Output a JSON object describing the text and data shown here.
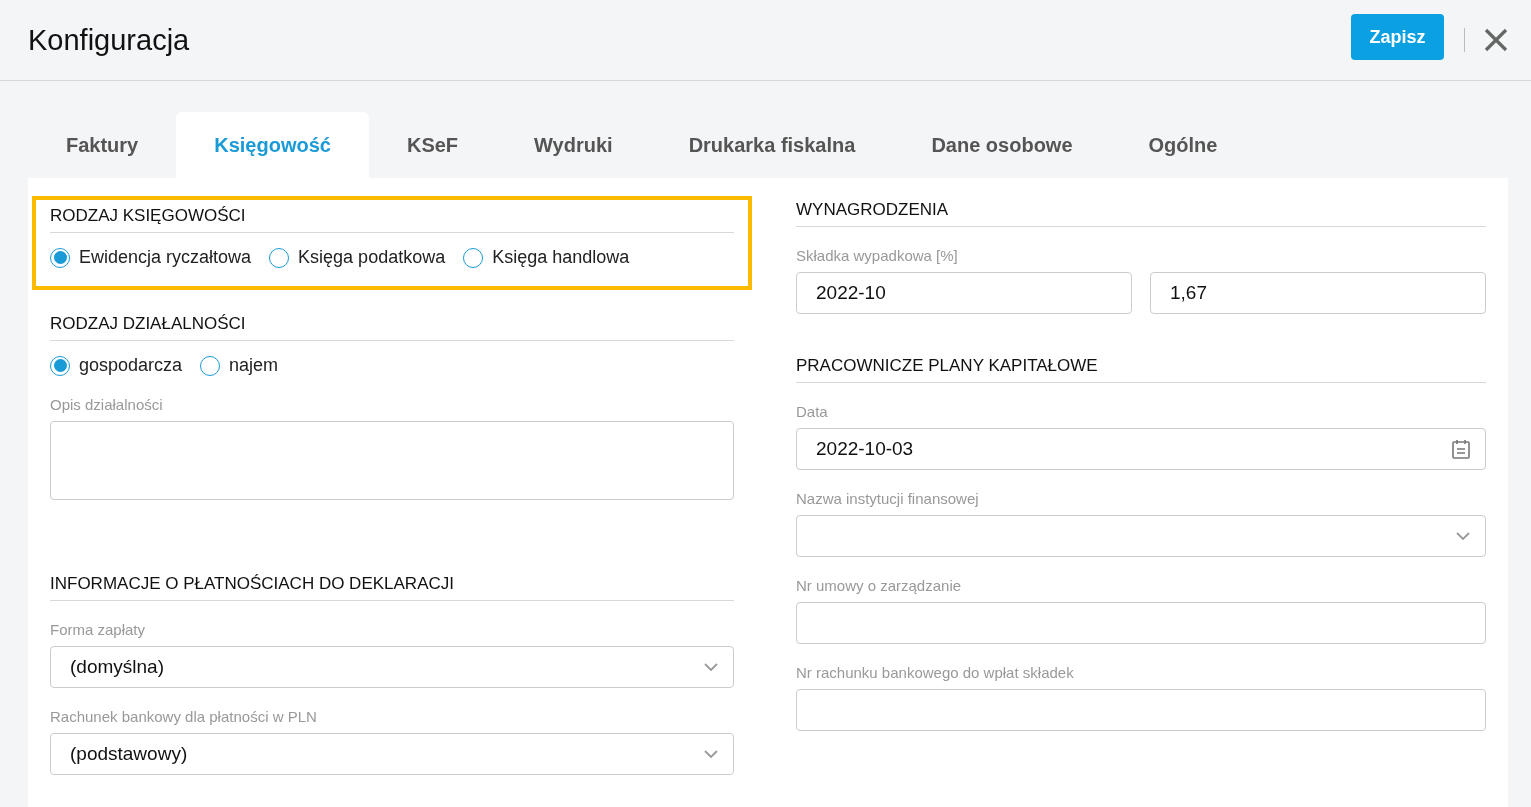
{
  "header": {
    "title": "Konfiguracja",
    "save_button": "Zapisz"
  },
  "tabs": [
    {
      "label": "Faktury",
      "selected": false
    },
    {
      "label": "Księgowość",
      "selected": true
    },
    {
      "label": "KSeF",
      "selected": false
    },
    {
      "label": "Wydruki",
      "selected": false
    },
    {
      "label": "Drukarka fiskalna",
      "selected": false
    },
    {
      "label": "Dane osobowe",
      "selected": false
    },
    {
      "label": "Ogólne",
      "selected": false
    }
  ],
  "left_sections": [
    {
      "title": "RODZAJ KSIĘGOWOŚCI",
      "highlighted": true,
      "fields": [
        {
          "kind": "radio",
          "options": [
            {
              "label": "Ewidencja ryczałtowa",
              "selected": true
            },
            {
              "label": "Księga podatkowa",
              "selected": false
            },
            {
              "label": "Księga handlowa",
              "selected": false
            }
          ]
        }
      ]
    },
    {
      "title": "RODZAJ DZIAŁALNOŚCI",
      "highlighted": false,
      "fields": [
        {
          "kind": "radio",
          "options": [
            {
              "label": "gospodarcza",
              "selected": true
            },
            {
              "label": "najem",
              "selected": false
            }
          ]
        },
        {
          "kind": "textarea",
          "label": "Opis działalności"
        }
      ]
    },
    {
      "title": "INFORMACJE O PŁATNOŚCIACH DO DEKLARACJI",
      "highlighted": false,
      "fields": [
        {
          "kind": "select",
          "label": "Forma zapłaty",
          "value": "(domyślna)"
        },
        {
          "kind": "select",
          "label": "Rachunek bankowy dla płatności w PLN",
          "value": "(podstawowy)"
        }
      ]
    }
  ],
  "right_sections": [
    {
      "title": "WYNAGRODZENIA",
      "highlighted": false,
      "fields": [
        {
          "kind": "pair",
          "label": "Składka wypadkowa [%]",
          "values": [
            "2022-10",
            "1,67"
          ]
        }
      ]
    },
    {
      "title": "PRACOWNICZE PLANY KAPITAŁOWE",
      "highlighted": false,
      "fields": [
        {
          "kind": "date",
          "label": "Data",
          "value": "2022-10-03"
        },
        {
          "kind": "select",
          "label": "Nazwa instytucji finansowej"
        },
        {
          "kind": "text",
          "label": "Nr umowy o zarządzanie"
        },
        {
          "kind": "text",
          "label": "Nr rachunku bankowego do wpłat składek"
        }
      ]
    }
  ]
}
